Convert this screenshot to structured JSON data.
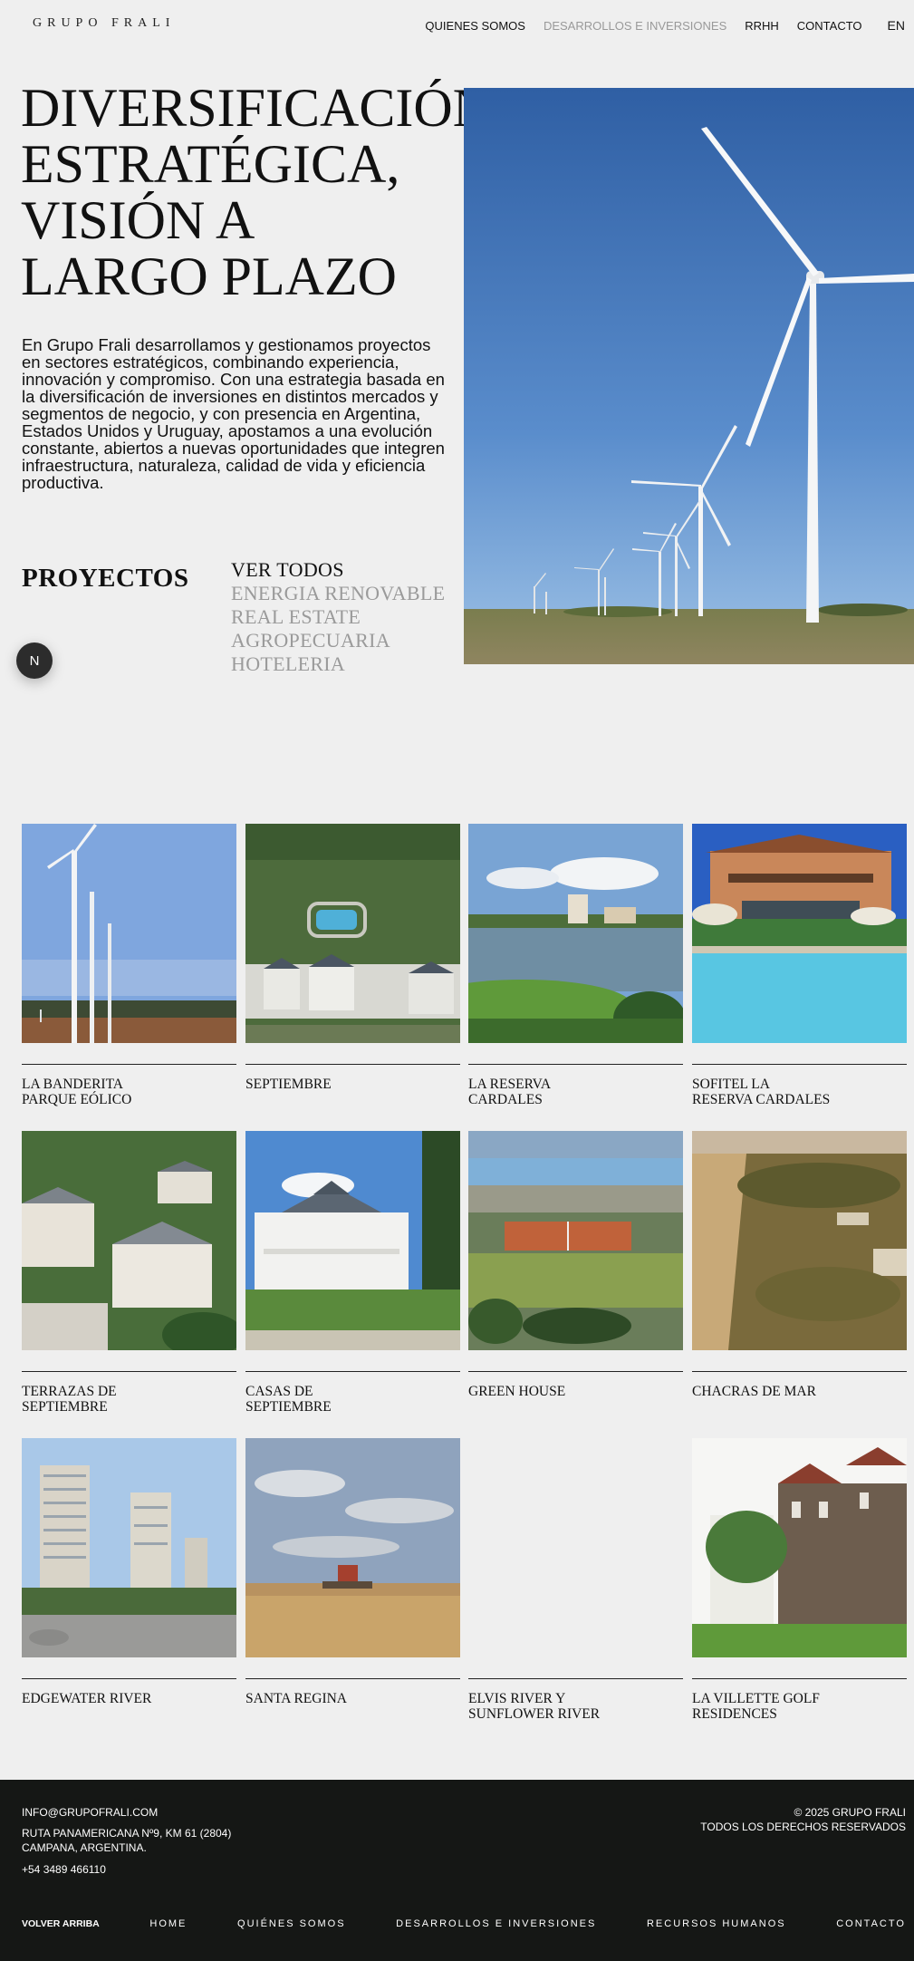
{
  "header": {
    "logo": "GRUPO FRALI",
    "nav": [
      {
        "label": "QUIENES SOMOS",
        "active": false
      },
      {
        "label": "DESARROLLOS E INVERSIONES",
        "active": true
      },
      {
        "label": "RRHH",
        "active": false
      },
      {
        "label": "CONTACTO",
        "active": false
      }
    ],
    "lang": "EN"
  },
  "hero": {
    "title_lines": [
      "DIVERSIFICACIÓN",
      "ESTRATÉGICA,",
      "VISIÓN A",
      "LARGO PLAZO"
    ],
    "text": "En Grupo Frali desarrollamos y gestionamos proyectos en sectores estratégicos, combinando experiencia, innovación y compromiso. Con una estrategia basada en la diversificación de inversiones en distintos mercados y segmentos de negocio, y con presencia en Argentina, Estados Unidos y Uruguay, apostamos a una evolución constante, abiertos a nuevas oportunidades que integren infraestructura, naturaleza, calidad de vida y eficiencia productiva."
  },
  "projects": {
    "heading": "PROYECTOS",
    "filters": [
      {
        "label": "VER TODOS",
        "active": true
      },
      {
        "label": "ENERGIA RENOVABLE",
        "active": false
      },
      {
        "label": "REAL ESTATE",
        "active": false
      },
      {
        "label": "AGROPECUARIA",
        "active": false
      },
      {
        "label": "HOTELERIA",
        "active": false
      }
    ],
    "fab": "N",
    "items": [
      {
        "name": "LA BANDERITA\nPARQUE EÓLICO",
        "image": "wind-farm"
      },
      {
        "name": "SEPTIEMBRE",
        "image": "aerial-houses"
      },
      {
        "name": "LA RESERVA\nCARDALES",
        "image": "lakeside-resort"
      },
      {
        "name": "SOFITEL LA\nRESERVA CARDALES",
        "image": "hotel-pool"
      },
      {
        "name": "TERRAZAS DE\nSEPTIEMBRE",
        "image": "aerial-condos"
      },
      {
        "name": "CASAS DE\nSEPTIEMBRE",
        "image": "white-house"
      },
      {
        "name": "GREEN HOUSE",
        "image": "tennis-courts"
      },
      {
        "name": "CHACRAS DE MAR",
        "image": "dunes"
      },
      {
        "name": "EDGEWATER RIVER",
        "image": "towers"
      },
      {
        "name": "SANTA REGINA",
        "image": "harvester-field"
      },
      {
        "name": "ELVIS RIVER Y\nSUNFLOWER RIVER",
        "image": "none"
      },
      {
        "name": "LA VILLETTE GOLF\nRESIDENCES",
        "image": "stone-building"
      }
    ]
  },
  "footer": {
    "email": "INFO@GRUPOFRALI.COM",
    "address_line1": "RUTA PANAMERICANA Nº9, KM 61 (2804)",
    "address_line2": "CAMPANA, ARGENTINA.",
    "phone": "+54 3489 466110",
    "copyright": "© 2025 GRUPO FRALI",
    "rights": "TODOS LOS DERECHOS RESERVADOS",
    "back_to_top": "VOLVER ARRIBA",
    "nav": [
      "HOME",
      "QUIÉNES SOMOS",
      "DESARROLLOS E INVERSIONES",
      "RECURSOS HUMANOS",
      "CONTACTO"
    ]
  }
}
